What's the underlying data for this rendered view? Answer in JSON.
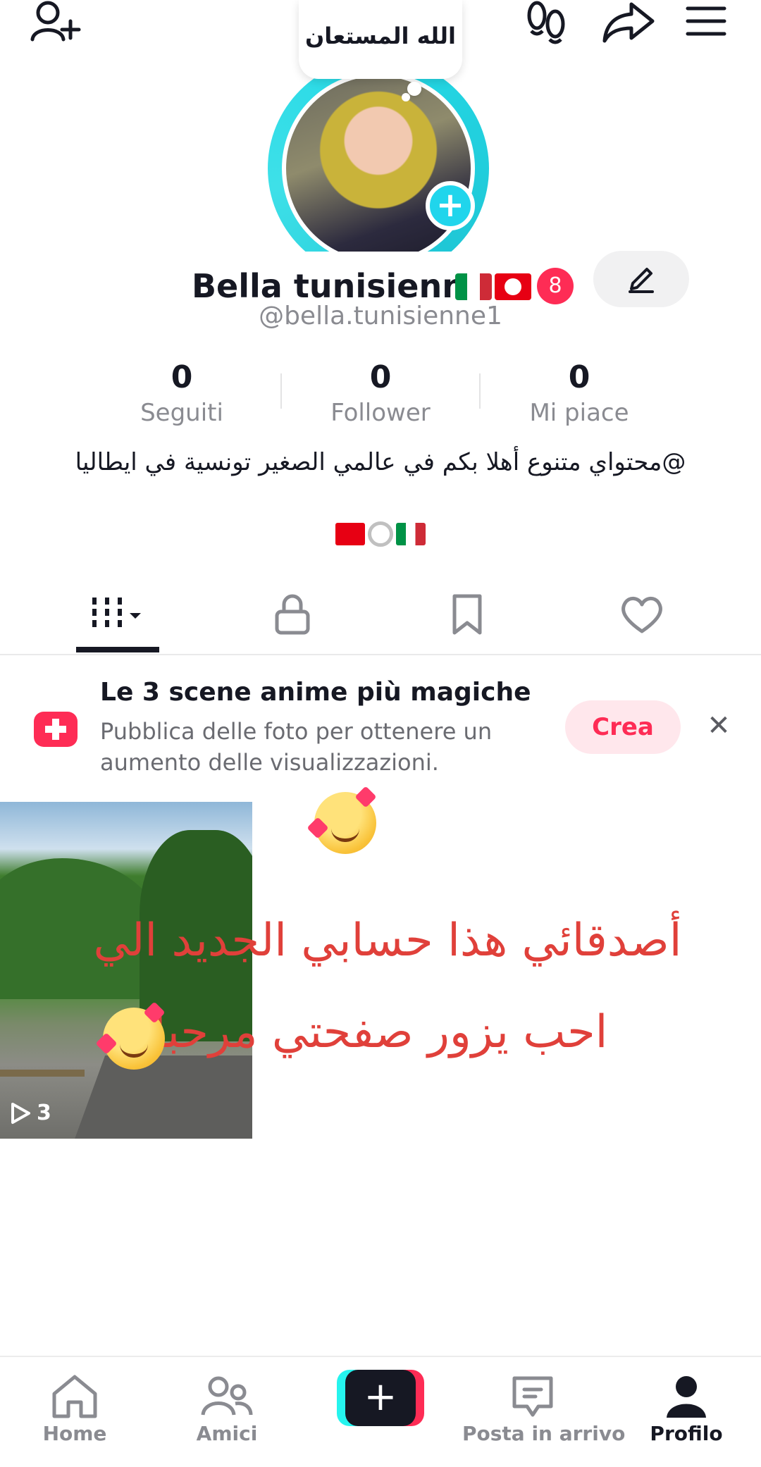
{
  "bubble": {
    "text": "الله المستعان"
  },
  "profile": {
    "display_name": "Bella tunisienne",
    "username": "@bella.tunisienne1",
    "notification_count": "8"
  },
  "stats": [
    {
      "value": "0",
      "label": "Seguiti"
    },
    {
      "value": "0",
      "label": "Follower"
    },
    {
      "value": "0",
      "label": "Mi piace"
    }
  ],
  "bio": {
    "text": "@محتواي متنوع أهلا بكم في عالمي الصغير تونسية في ايطاليا"
  },
  "tabs": [
    {
      "name": "videos-grid-icon"
    },
    {
      "name": "lock-icon"
    },
    {
      "name": "bookmark-icon"
    },
    {
      "name": "heart-icon"
    }
  ],
  "banner": {
    "title": "Le 3 scene anime più magiche",
    "description": "Pubblica delle foto per ottenere un aumento delle visualizzazioni.",
    "create_label": "Crea",
    "close_label": "✕"
  },
  "video": {
    "play_count": "3"
  },
  "overlay": {
    "line1": "أصدقائي هذا حسابي الجديد الي",
    "line2": "احب يزور صفحتي مرحبا"
  },
  "nav": {
    "home": "Home",
    "friends": "Amici",
    "create": "+",
    "inbox": "Posta in arrivo",
    "profile": "Profilo"
  },
  "colors": {
    "accent": "#fe2c55",
    "cyan": "#20d5ec",
    "overlay_text": "#e0403a"
  }
}
